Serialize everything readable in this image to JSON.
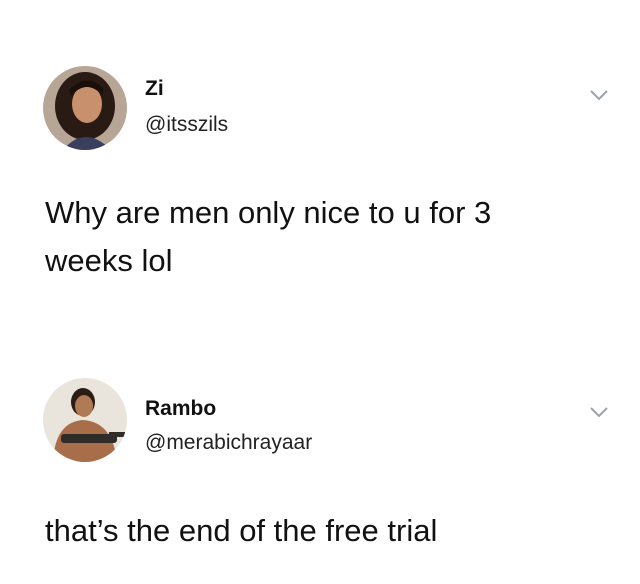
{
  "tweets": [
    {
      "display_name": "Zi",
      "handle": "@itsszils",
      "text": "Why are men only nice to u for 3 weeks lol",
      "avatar_icon": "woman-portrait-avatar",
      "menu_icon": "chevron-down-icon"
    },
    {
      "display_name": "Rambo",
      "handle": "@merabichrayaar",
      "text": "that’s the end of the free trial",
      "avatar_icon": "man-with-gun-avatar",
      "menu_icon": "chevron-down-icon"
    }
  ]
}
